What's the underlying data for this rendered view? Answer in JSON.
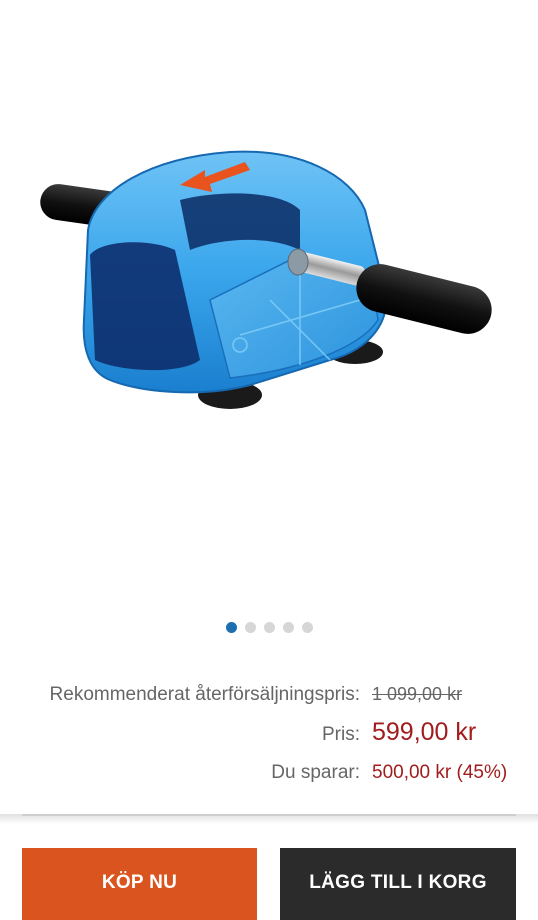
{
  "product": {
    "image_alt": "Blue ab roller wheel with black foam handles"
  },
  "carousel": {
    "total": 5,
    "active_index": 1
  },
  "pricing": {
    "rrp_label": "Rekommenderat återförsäljningspris:",
    "rrp_value": "1 099,00 kr",
    "price_label": "Pris:",
    "price_value": "599,00 kr",
    "save_label": "Du sparar:",
    "save_value": "500,00 kr (45%)"
  },
  "actions": {
    "buy_now": "KÖP NU",
    "add_to_cart": "LÄGG TILL I KORG"
  },
  "colors": {
    "accent_blue": "#1c6fb0",
    "price_red": "#a11c1c",
    "buy_orange": "#d9541e",
    "cart_dark": "#2b2b2b"
  }
}
